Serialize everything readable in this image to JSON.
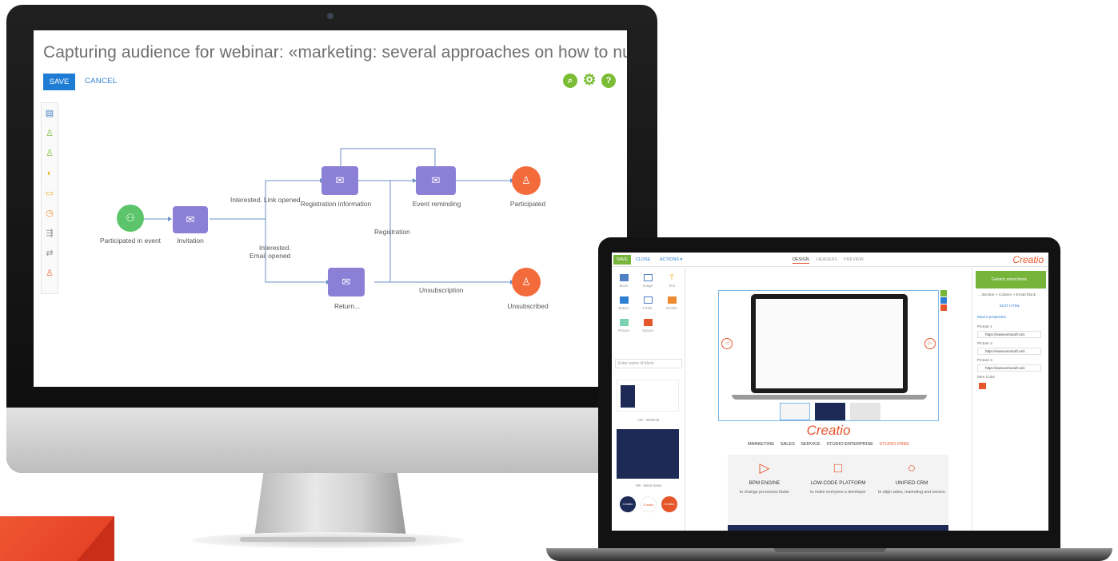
{
  "imac": {
    "process_title": "Capturing audience for webinar: «marketing: several approaches on how to nurture y...",
    "save_label": "SAVE",
    "cancel_label": "CANCEL",
    "nodes": {
      "participated_in_event": "Participated in event",
      "invitation": "Invitation",
      "registration_information": "Registration information",
      "event_reminding": "Event reminding",
      "participated": "Participated",
      "return": "Return...",
      "unsubscribed": "Unsubscribed"
    },
    "edges": {
      "interested_link_opened": "Interested. Link opened",
      "interested": "Interested.",
      "email_opened": "Email opened",
      "registration": "Registration",
      "unsubscription": "Unsubscription"
    }
  },
  "laptop": {
    "toolbar": {
      "save": "SAVE",
      "close": "CLOSE",
      "actions": "ACTIONS ▾",
      "tabs": [
        "DESIGN",
        "HEADERS",
        "PREVIEW"
      ],
      "logo": "Creatio"
    },
    "blocks": [
      "Block",
      "Image",
      "Text",
      "Button",
      "HTML",
      "Divider",
      "Picture",
      "Spacer"
    ],
    "search_placeholder": "Enter name of block",
    "template_captions": [
      "HR - Webinar",
      "HR - Back News"
    ],
    "circle_labels": [
      "Creatio",
      "Creatio",
      "Creatio"
    ],
    "right_panel": {
      "header": "Generic email block",
      "breadcrumb": "... Section » Column » Email block",
      "edit_html": "EDIT HTML",
      "macro_properties": "Macro properties",
      "pictures": [
        {
          "label": "Picture 1",
          "value": "https://www.terrasoft.ru/s"
        },
        {
          "label": "Picture 2",
          "value": "https://www.terrasoft.ru/s"
        },
        {
          "label": "Picture 3",
          "value": "https://www.terrasoft.ru/s"
        }
      ],
      "item_color_label": "Item Color"
    },
    "preview": {
      "logo": "Creatio",
      "menu": [
        "MARKETING",
        "SALES",
        "SERVICE",
        "STUDIO ENTERPRISE",
        "STUDIO FREE"
      ],
      "features": [
        {
          "title": "BPM ENGINE",
          "desc": "to change processes faster"
        },
        {
          "title": "LOW-CODE PLATFORM",
          "desc": "to make everyone a developer"
        },
        {
          "title": "UNIFIED CRM",
          "desc": "to align sales, marketing and service"
        }
      ]
    }
  },
  "colors": {
    "brand_orange": "#e5562b",
    "process_purple": "#8b7fd6",
    "start_green": "#5cc46a",
    "end_orange": "#f36b3b",
    "accent_green": "#7bbd35",
    "link_blue": "#2c7fd1"
  }
}
